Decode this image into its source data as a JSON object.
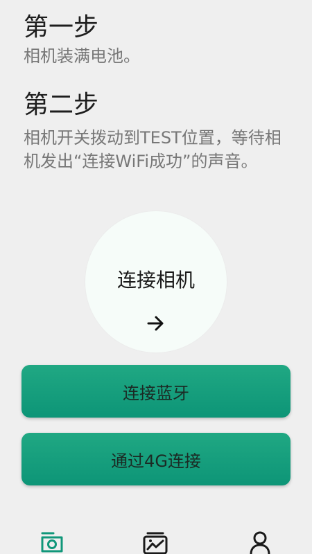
{
  "step1": {
    "title": "第一步",
    "description": "相机装满电池。"
  },
  "step2": {
    "title": "第二步",
    "description": "相机开关拨动到TEST位置，等待相机发出“连接WiFi成功”的声音。"
  },
  "connect_camera": {
    "label": "连接相机",
    "icon": "arrow-right-icon"
  },
  "buttons": {
    "bluetooth": "连接蓝牙",
    "via_4g": "通过4G连接"
  },
  "tabbar": {
    "items": [
      {
        "icon": "camera-icon",
        "active": true
      },
      {
        "icon": "gallery-icon",
        "active": false
      },
      {
        "icon": "profile-icon",
        "active": false
      }
    ]
  },
  "colors": {
    "accent": "#10977a",
    "background": "#efefef",
    "circle": "#f6fcf9"
  }
}
